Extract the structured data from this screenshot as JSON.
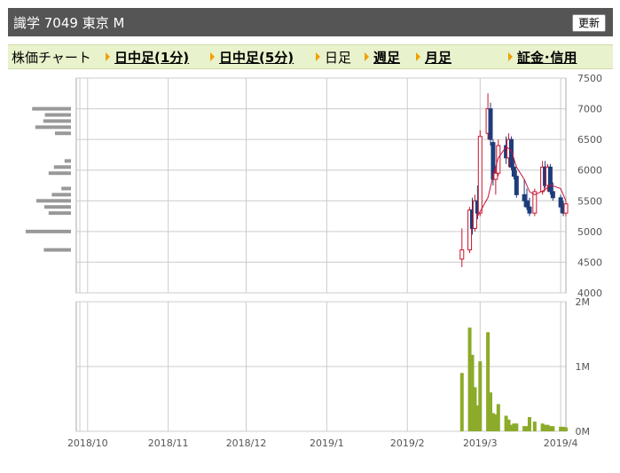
{
  "header": {
    "title": "識学 7049 東京 M",
    "refresh_label": "更新"
  },
  "menu": {
    "items": [
      {
        "label": "株価チャート",
        "link": false,
        "arrow": false
      },
      {
        "label": "日中足(1分)",
        "link": true,
        "arrow": true
      },
      {
        "label": "日中足(5分)",
        "link": true,
        "arrow": true
      },
      {
        "label": "日足",
        "link": false,
        "arrow": true
      },
      {
        "label": "週足",
        "link": true,
        "arrow": true
      },
      {
        "label": "月足",
        "link": true,
        "arrow": true
      },
      {
        "label": "証金･信用",
        "link": true,
        "arrow": true
      }
    ]
  },
  "colors": {
    "up": "#c8142a",
    "down": "#1e3c7a",
    "ma": "#c8143c",
    "volume": "#8cab2a",
    "grid": "#cccccc",
    "axis_text": "#555555",
    "profile": "#999999"
  },
  "chart_data": [
    {
      "type": "candlestick",
      "ylim": [
        4000,
        7500
      ],
      "yticks": [
        4000,
        4500,
        5000,
        5500,
        6000,
        6500,
        7000,
        7500
      ],
      "xlim": [
        "2018-09-28",
        "2019-04-03"
      ],
      "xticks": [
        {
          "date": "2018-10-01",
          "label": "2018/10"
        },
        {
          "date": "2018-11-01",
          "label": "2018/11"
        },
        {
          "date": "2018-12-01",
          "label": "2018/12"
        },
        {
          "date": "2019-01-01",
          "label": "2019/1"
        },
        {
          "date": "2019-02-01",
          "label": "2019/2"
        },
        {
          "date": "2019-03-01",
          "label": "2019/3"
        },
        {
          "date": "2019-04-01",
          "label": "2019/4"
        }
      ],
      "candles": [
        {
          "date": "2019-02-22",
          "open": 4550,
          "high": 5050,
          "low": 4420,
          "close": 4700
        },
        {
          "date": "2019-02-25",
          "open": 4700,
          "high": 5400,
          "low": 4650,
          "close": 5350
        },
        {
          "date": "2019-02-26",
          "open": 5350,
          "high": 5550,
          "low": 4950,
          "close": 5050
        },
        {
          "date": "2019-02-27",
          "open": 5050,
          "high": 5600,
          "low": 5000,
          "close": 5500
        },
        {
          "date": "2019-02-28",
          "open": 5500,
          "high": 5750,
          "low": 5200,
          "close": 5300
        },
        {
          "date": "2019-03-01",
          "open": 5300,
          "high": 6650,
          "low": 5250,
          "close": 6550
        },
        {
          "date": "2019-03-04",
          "open": 6600,
          "high": 7250,
          "low": 6500,
          "close": 7000
        },
        {
          "date": "2019-03-05",
          "open": 7000,
          "high": 7100,
          "low": 6400,
          "close": 6500
        },
        {
          "date": "2019-03-06",
          "open": 6450,
          "high": 6500,
          "low": 5750,
          "close": 5850
        },
        {
          "date": "2019-03-07",
          "open": 5850,
          "high": 6050,
          "low": 5600,
          "close": 5950
        },
        {
          "date": "2019-03-08",
          "open": 5950,
          "high": 6500,
          "low": 5900,
          "close": 6400
        },
        {
          "date": "2019-03-11",
          "open": 6400,
          "high": 6550,
          "low": 6100,
          "close": 6200
        },
        {
          "date": "2019-03-12",
          "open": 6200,
          "high": 6600,
          "low": 6050,
          "close": 6500
        },
        {
          "date": "2019-03-13",
          "open": 6500,
          "high": 6550,
          "low": 6000,
          "close": 6050
        },
        {
          "date": "2019-03-14",
          "open": 6050,
          "high": 6200,
          "low": 5850,
          "close": 5900
        },
        {
          "date": "2019-03-15",
          "open": 5900,
          "high": 6000,
          "low": 5550,
          "close": 5600
        },
        {
          "date": "2019-03-18",
          "open": 5600,
          "high": 5850,
          "low": 5400,
          "close": 5500
        },
        {
          "date": "2019-03-19",
          "open": 5500,
          "high": 5700,
          "low": 5350,
          "close": 5400
        },
        {
          "date": "2019-03-20",
          "open": 5400,
          "high": 5550,
          "low": 5250,
          "close": 5300
        },
        {
          "date": "2019-03-22",
          "open": 5300,
          "high": 5700,
          "low": 5250,
          "close": 5650
        },
        {
          "date": "2019-03-25",
          "open": 5650,
          "high": 6150,
          "low": 5600,
          "close": 6050
        },
        {
          "date": "2019-03-26",
          "open": 6050,
          "high": 6150,
          "low": 5700,
          "close": 5750
        },
        {
          "date": "2019-03-27",
          "open": 5750,
          "high": 6100,
          "low": 5650,
          "close": 6050
        },
        {
          "date": "2019-03-28",
          "open": 6050,
          "high": 6100,
          "low": 5600,
          "close": 5650
        },
        {
          "date": "2019-03-29",
          "open": 5650,
          "high": 5800,
          "low": 5500,
          "close": 5550
        },
        {
          "date": "2019-04-01",
          "open": 5550,
          "high": 5600,
          "low": 5300,
          "close": 5400
        },
        {
          "date": "2019-04-02",
          "open": 5400,
          "high": 5500,
          "low": 5250,
          "close": 5300
        },
        {
          "date": "2019-04-03",
          "open": 5300,
          "high": 5500,
          "low": 5250,
          "close": 5450
        }
      ],
      "moving_average": [
        {
          "date": "2019-02-28",
          "value": 5250
        },
        {
          "date": "2019-03-04",
          "value": 5550
        },
        {
          "date": "2019-03-06",
          "value": 5900
        },
        {
          "date": "2019-03-08",
          "value": 6200
        },
        {
          "date": "2019-03-11",
          "value": 6380
        },
        {
          "date": "2019-03-13",
          "value": 6320
        },
        {
          "date": "2019-03-15",
          "value": 6050
        },
        {
          "date": "2019-03-18",
          "value": 5850
        },
        {
          "date": "2019-03-20",
          "value": 5650
        },
        {
          "date": "2019-03-22",
          "value": 5600
        },
        {
          "date": "2019-03-26",
          "value": 5680
        },
        {
          "date": "2019-03-28",
          "value": 5760
        },
        {
          "date": "2019-04-01",
          "value": 5700
        },
        {
          "date": "2019-04-03",
          "value": 5500
        }
      ],
      "volume_profile": [
        {
          "price": 7000,
          "value": 0.73
        },
        {
          "price": 6900,
          "value": 0.49
        },
        {
          "price": 6800,
          "value": 0.52
        },
        {
          "price": 6700,
          "value": 0.67
        },
        {
          "price": 6600,
          "value": 0.3
        },
        {
          "price": 6150,
          "value": 0.12
        },
        {
          "price": 6050,
          "value": 0.32
        },
        {
          "price": 5950,
          "value": 0.42
        },
        {
          "price": 5700,
          "value": 0.18
        },
        {
          "price": 5600,
          "value": 0.36
        },
        {
          "price": 5500,
          "value": 0.65
        },
        {
          "price": 5400,
          "value": 0.5
        },
        {
          "price": 5300,
          "value": 0.42
        },
        {
          "price": 5000,
          "value": 0.85
        },
        {
          "price": 4700,
          "value": 0.51
        }
      ]
    },
    {
      "type": "bar",
      "ylim": [
        0,
        2000000
      ],
      "yticks": [
        {
          "value": 0,
          "label": "0M"
        },
        {
          "value": 1000000,
          "label": "1M"
        },
        {
          "value": 2000000,
          "label": "2M"
        }
      ],
      "volume": [
        {
          "date": "2019-02-22",
          "value": 900000
        },
        {
          "date": "2019-02-25",
          "value": 1600000
        },
        {
          "date": "2019-02-26",
          "value": 1180000
        },
        {
          "date": "2019-02-27",
          "value": 680000
        },
        {
          "date": "2019-02-28",
          "value": 400000
        },
        {
          "date": "2019-03-01",
          "value": 1080000
        },
        {
          "date": "2019-03-04",
          "value": 1530000
        },
        {
          "date": "2019-03-05",
          "value": 600000
        },
        {
          "date": "2019-03-06",
          "value": 280000
        },
        {
          "date": "2019-03-07",
          "value": 260000
        },
        {
          "date": "2019-03-08",
          "value": 420000
        },
        {
          "date": "2019-03-11",
          "value": 240000
        },
        {
          "date": "2019-03-12",
          "value": 180000
        },
        {
          "date": "2019-03-13",
          "value": 100000
        },
        {
          "date": "2019-03-14",
          "value": 120000
        },
        {
          "date": "2019-03-15",
          "value": 120000
        },
        {
          "date": "2019-03-18",
          "value": 80000
        },
        {
          "date": "2019-03-19",
          "value": 80000
        },
        {
          "date": "2019-03-20",
          "value": 220000
        },
        {
          "date": "2019-03-22",
          "value": 150000
        },
        {
          "date": "2019-03-25",
          "value": 120000
        },
        {
          "date": "2019-03-26",
          "value": 100000
        },
        {
          "date": "2019-03-27",
          "value": 100000
        },
        {
          "date": "2019-03-28",
          "value": 80000
        },
        {
          "date": "2019-03-29",
          "value": 80000
        },
        {
          "date": "2019-04-01",
          "value": 70000
        },
        {
          "date": "2019-04-02",
          "value": 70000
        },
        {
          "date": "2019-04-03",
          "value": 60000
        }
      ]
    }
  ]
}
